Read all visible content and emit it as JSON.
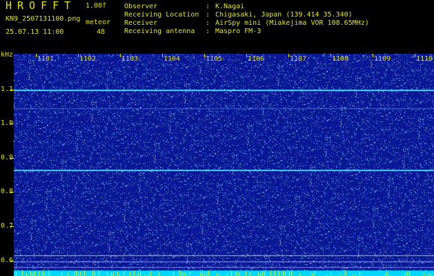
{
  "header": {
    "app_title": "HROFFT",
    "version": "1.00f",
    "filename": "KN9_2507131100.png",
    "meteor_label": "meteor",
    "datetime": "25.07.13 11:00",
    "meteor_count": "48"
  },
  "info": [
    {
      "key": "Observer",
      "value": "K.Nagai"
    },
    {
      "key": "Receiving Location",
      "value": "Chigasaki, Japan (139.414 35.340)"
    },
    {
      "key": "Receiver",
      "value": "AirSpy mini (Miakejima VOR 108.65MHz)"
    },
    {
      "key": "Receiving antenna",
      "value": "Maspro FM-3"
    }
  ],
  "axis": {
    "unit": "kHz",
    "y_labels": [
      "1.1",
      "1.0",
      "0.9",
      "0.8",
      "0.7",
      "0.6"
    ],
    "x_labels": [
      "1101",
      "1102",
      "1103",
      "1104",
      "1105",
      "1106",
      "1107",
      "1108",
      "1109",
      "1110"
    ]
  },
  "colors": {
    "text": "#e0e000",
    "background": "#000000",
    "noise_base": "#0a1a8a",
    "carrier": "#40e0ff",
    "bottom_band": "#00e0ff"
  }
}
